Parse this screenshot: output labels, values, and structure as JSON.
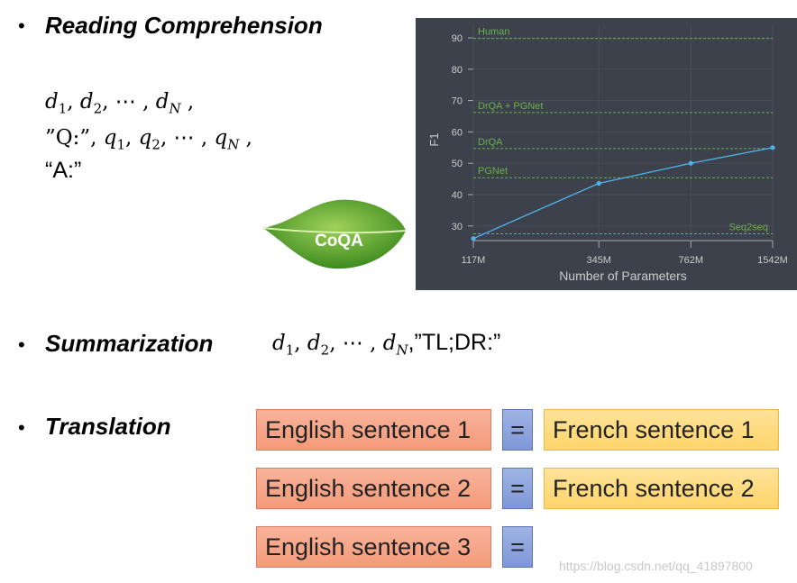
{
  "sections": {
    "reading": {
      "bullet": "•",
      "title": "Reading Comprehension",
      "line1": "d1, d2, ⋯ , dN ,",
      "line2": "”Q:”, q1, q2, ⋯ , qN ,",
      "line3": "“A:”"
    },
    "summarization": {
      "bullet": "•",
      "title": "Summarization",
      "formula_tail": ",”TL;DR:”"
    },
    "translation": {
      "bullet": "•",
      "title": "Translation",
      "rows": [
        {
          "english": "English sentence 1",
          "eq": "=",
          "french": "French sentence 1"
        },
        {
          "english": "English sentence 2",
          "eq": "=",
          "french": "French sentence 2"
        },
        {
          "english": "English sentence 3",
          "eq": "="
        }
      ]
    }
  },
  "logo": {
    "text": "CoQA",
    "color": "#4f9a2a"
  },
  "watermark": "https://blog.csdn.net/qq_41897800",
  "chart_data": {
    "type": "line",
    "xlabel": "Number of Parameters",
    "ylabel": "F1",
    "xscale": "log",
    "x": [
      "117M",
      "345M",
      "762M",
      "1542M"
    ],
    "x_values": [
      117,
      345,
      762,
      1542
    ],
    "y": [
      26,
      43.6,
      50,
      55
    ],
    "yticks": [
      30,
      40,
      50,
      60,
      70,
      80,
      90
    ],
    "ylim": [
      25.3,
      92
    ],
    "baselines": [
      {
        "name": "Human",
        "value": 89.8
      },
      {
        "name": "DrQA + PGNet",
        "value": 66.2
      },
      {
        "name": "DrQA",
        "value": 54.7
      },
      {
        "name": "PGNet",
        "value": 45.4
      },
      {
        "name": "Seq2seq",
        "value": 27.5
      }
    ],
    "colors": {
      "line": "#4fb3e8",
      "baseline": "#6ab04c",
      "background": "#3d414c"
    },
    "grid": true
  }
}
